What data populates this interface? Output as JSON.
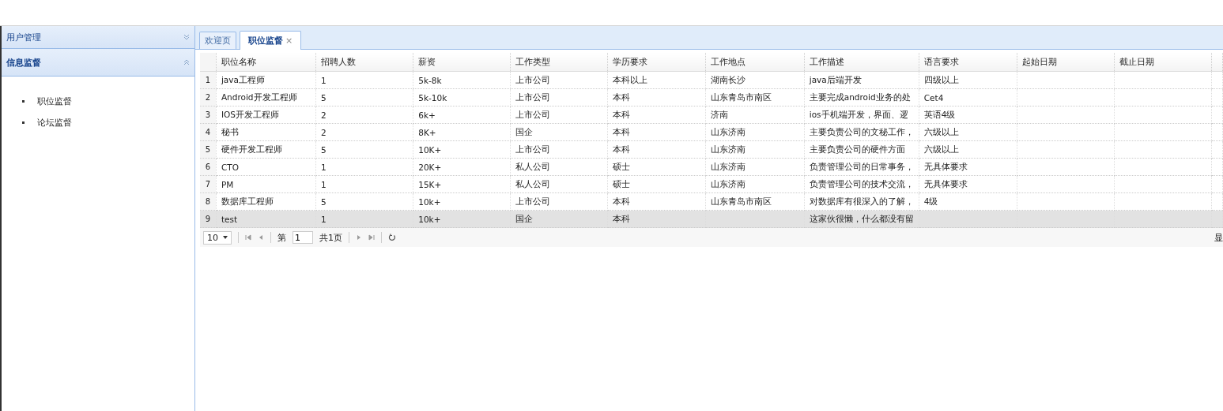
{
  "sidebar": {
    "panels": [
      {
        "title": "用户管理",
        "expanded": false
      },
      {
        "title": "信息监督",
        "expanded": true,
        "items": [
          {
            "label": "职位监督"
          },
          {
            "label": "论坛监督"
          }
        ]
      }
    ]
  },
  "tabs": [
    {
      "label": "欢迎页",
      "selected": false
    },
    {
      "label": "职位监督",
      "selected": true,
      "close": "×"
    }
  ],
  "table": {
    "columns": [
      "职位名称",
      "招聘人数",
      "薪资",
      "工作类型",
      "学历要求",
      "工作地点",
      "工作描述",
      "语言要求",
      "起始日期",
      "截止日期"
    ],
    "rows": [
      {
        "num": "1",
        "hovered": false,
        "cells": [
          "java工程师",
          "1",
          "5k-8k",
          "上市公司",
          "本科以上",
          "湖南长沙",
          "java后端开发",
          "四级以上",
          "",
          ""
        ]
      },
      {
        "num": "2",
        "hovered": false,
        "cells": [
          "Android开发工程师",
          "5",
          "5k-10k",
          "上市公司",
          "本科",
          "山东青岛市南区",
          "主要完成android业务的处",
          "Cet4",
          "",
          ""
        ]
      },
      {
        "num": "3",
        "hovered": false,
        "cells": [
          "IOS开发工程师",
          "2",
          "6k+",
          "上市公司",
          "本科",
          "济南",
          "ios手机端开发，界面、逻",
          "英语4级",
          "",
          ""
        ]
      },
      {
        "num": "4",
        "hovered": false,
        "cells": [
          "秘书",
          "2",
          "8K+",
          "国企",
          "本科",
          "山东济南",
          "主要负责公司的文秘工作，",
          "六级以上",
          "",
          ""
        ]
      },
      {
        "num": "5",
        "hovered": false,
        "cells": [
          "硬件开发工程师",
          "5",
          "10K+",
          "上市公司",
          "本科",
          "山东济南",
          "主要负责公司的硬件方面",
          "六级以上",
          "",
          ""
        ]
      },
      {
        "num": "6",
        "hovered": false,
        "cells": [
          "CTO",
          "1",
          "20K+",
          "私人公司",
          "硕士",
          "山东济南",
          "负责管理公司的日常事务，",
          "无具体要求",
          "",
          ""
        ]
      },
      {
        "num": "7",
        "hovered": false,
        "cells": [
          "PM",
          "1",
          "15K+",
          "私人公司",
          "硕士",
          "山东济南",
          "负责管理公司的技术交流，",
          "无具体要求",
          "",
          ""
        ]
      },
      {
        "num": "8",
        "hovered": false,
        "cells": [
          "数据库工程师",
          "5",
          "10k+",
          "上市公司",
          "本科",
          "山东青岛市南区",
          "对数据库有很深入的了解，",
          "4级",
          "",
          ""
        ]
      },
      {
        "num": "9",
        "hovered": true,
        "cells": [
          "test",
          "1",
          "10k+",
          "国企",
          "本科",
          "",
          "这家伙很懒，什么都没有留",
          "",
          "",
          ""
        ]
      }
    ]
  },
  "pager": {
    "page_size": "10",
    "page_prefix": "第",
    "page": "1",
    "page_total": "共1页",
    "info": "显"
  }
}
